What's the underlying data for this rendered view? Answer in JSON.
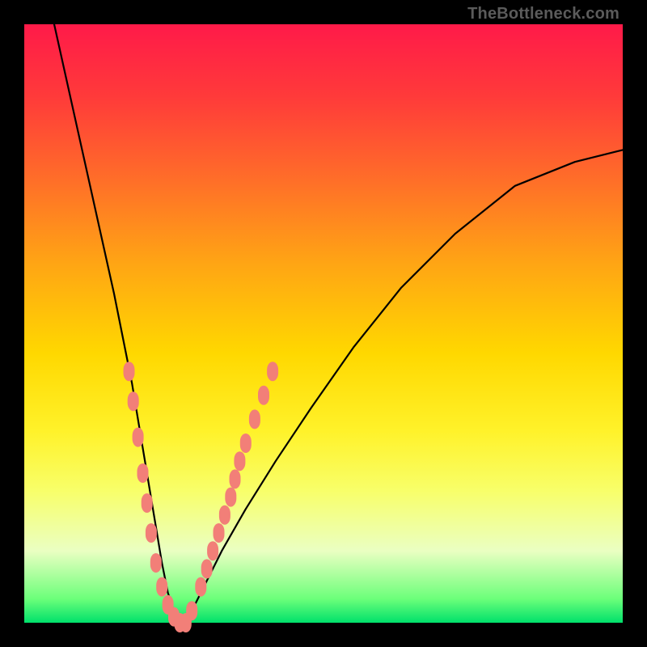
{
  "watermark": "TheBottleneck.com",
  "chart_data": {
    "type": "line",
    "title": "",
    "xlabel": "",
    "ylabel": "",
    "xlim": [
      0,
      100
    ],
    "ylim": [
      0,
      100
    ],
    "grid": false,
    "legend": false,
    "background_gradient": {
      "direction": "vertical",
      "stops": [
        {
          "pos": 0.0,
          "color": "#ff1a49"
        },
        {
          "pos": 0.25,
          "color": "#ff6a2a"
        },
        {
          "pos": 0.55,
          "color": "#ffd800"
        },
        {
          "pos": 0.78,
          "color": "#f8ff6a"
        },
        {
          "pos": 0.96,
          "color": "#6cff7a"
        },
        {
          "pos": 1.0,
          "color": "#00e06b"
        }
      ]
    },
    "series": [
      {
        "name": "curve",
        "color": "#000000",
        "x": [
          5,
          7,
          9,
          11,
          13,
          15,
          16,
          17,
          18,
          19,
          20,
          21,
          22,
          23,
          24,
          25,
          26,
          27,
          28,
          30,
          33,
          37,
          42,
          48,
          55,
          63,
          72,
          82,
          92,
          100
        ],
        "y": [
          100,
          91,
          82,
          73,
          64,
          55,
          50,
          45,
          40,
          34,
          28,
          22,
          16,
          10,
          5,
          2,
          0,
          0,
          2,
          6,
          12,
          19,
          27,
          36,
          46,
          56,
          65,
          73,
          77,
          79
        ]
      }
    ],
    "markers": {
      "name": "highlight-dots",
      "color": "#f27f78",
      "points": [
        {
          "x": 17.5,
          "y": 42
        },
        {
          "x": 18.2,
          "y": 37
        },
        {
          "x": 19.0,
          "y": 31
        },
        {
          "x": 19.8,
          "y": 25
        },
        {
          "x": 20.5,
          "y": 20
        },
        {
          "x": 21.2,
          "y": 15
        },
        {
          "x": 22.0,
          "y": 10
        },
        {
          "x": 23.0,
          "y": 6
        },
        {
          "x": 24.0,
          "y": 3
        },
        {
          "x": 25.0,
          "y": 1
        },
        {
          "x": 26.0,
          "y": 0
        },
        {
          "x": 27.0,
          "y": 0
        },
        {
          "x": 28.0,
          "y": 2
        },
        {
          "x": 29.5,
          "y": 6
        },
        {
          "x": 30.5,
          "y": 9
        },
        {
          "x": 31.5,
          "y": 12
        },
        {
          "x": 32.5,
          "y": 15
        },
        {
          "x": 33.5,
          "y": 18
        },
        {
          "x": 34.5,
          "y": 21
        },
        {
          "x": 35.2,
          "y": 24
        },
        {
          "x": 36.0,
          "y": 27
        },
        {
          "x": 37.0,
          "y": 30
        },
        {
          "x": 38.5,
          "y": 34
        },
        {
          "x": 40.0,
          "y": 38
        },
        {
          "x": 41.5,
          "y": 42
        }
      ]
    }
  }
}
